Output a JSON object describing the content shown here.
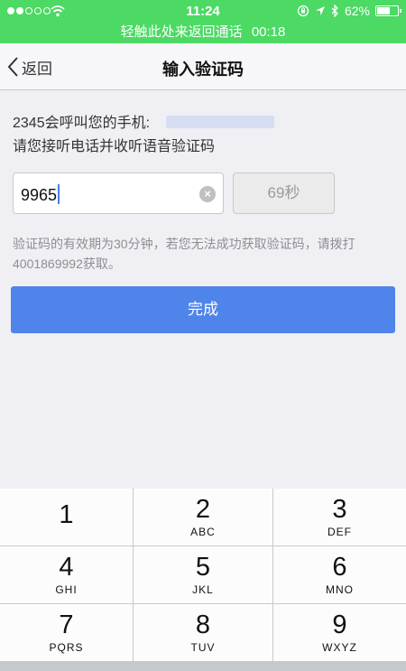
{
  "status_bar": {
    "time": "11:24",
    "battery_text": "62%",
    "battery_level": 0.62,
    "call_banner_text": "轻触此处来返回通话",
    "call_duration": "00:18"
  },
  "nav": {
    "back_label": "返回",
    "title": "输入验证码"
  },
  "info": {
    "line1": "2345会呼叫您的手机:",
    "line2": "请您接听电话并收听语音验证码"
  },
  "code_input": {
    "value": "9965"
  },
  "countdown_label": "69秒",
  "hint": "验证码的有效期为30分钟，若您无法成功获取验证码，请拨打4001869992获取。",
  "done_label": "完成",
  "keypad": [
    {
      "num": "1",
      "letters": ""
    },
    {
      "num": "2",
      "letters": "ABC"
    },
    {
      "num": "3",
      "letters": "DEF"
    },
    {
      "num": "4",
      "letters": "GHI"
    },
    {
      "num": "5",
      "letters": "JKL"
    },
    {
      "num": "6",
      "letters": "MNO"
    },
    {
      "num": "7",
      "letters": "PQRS"
    },
    {
      "num": "8",
      "letters": "TUV"
    },
    {
      "num": "9",
      "letters": "WXYZ"
    }
  ],
  "colors": {
    "status_green": "#4cd964",
    "button_blue": "#4f85ea",
    "background": "#efeff4"
  },
  "icons": [
    "signal-dots-icon",
    "wifi-icon",
    "lock-rotation-icon",
    "location-arrow-icon",
    "bluetooth-icon",
    "battery-icon",
    "chevron-left-icon",
    "clear-icon"
  ]
}
